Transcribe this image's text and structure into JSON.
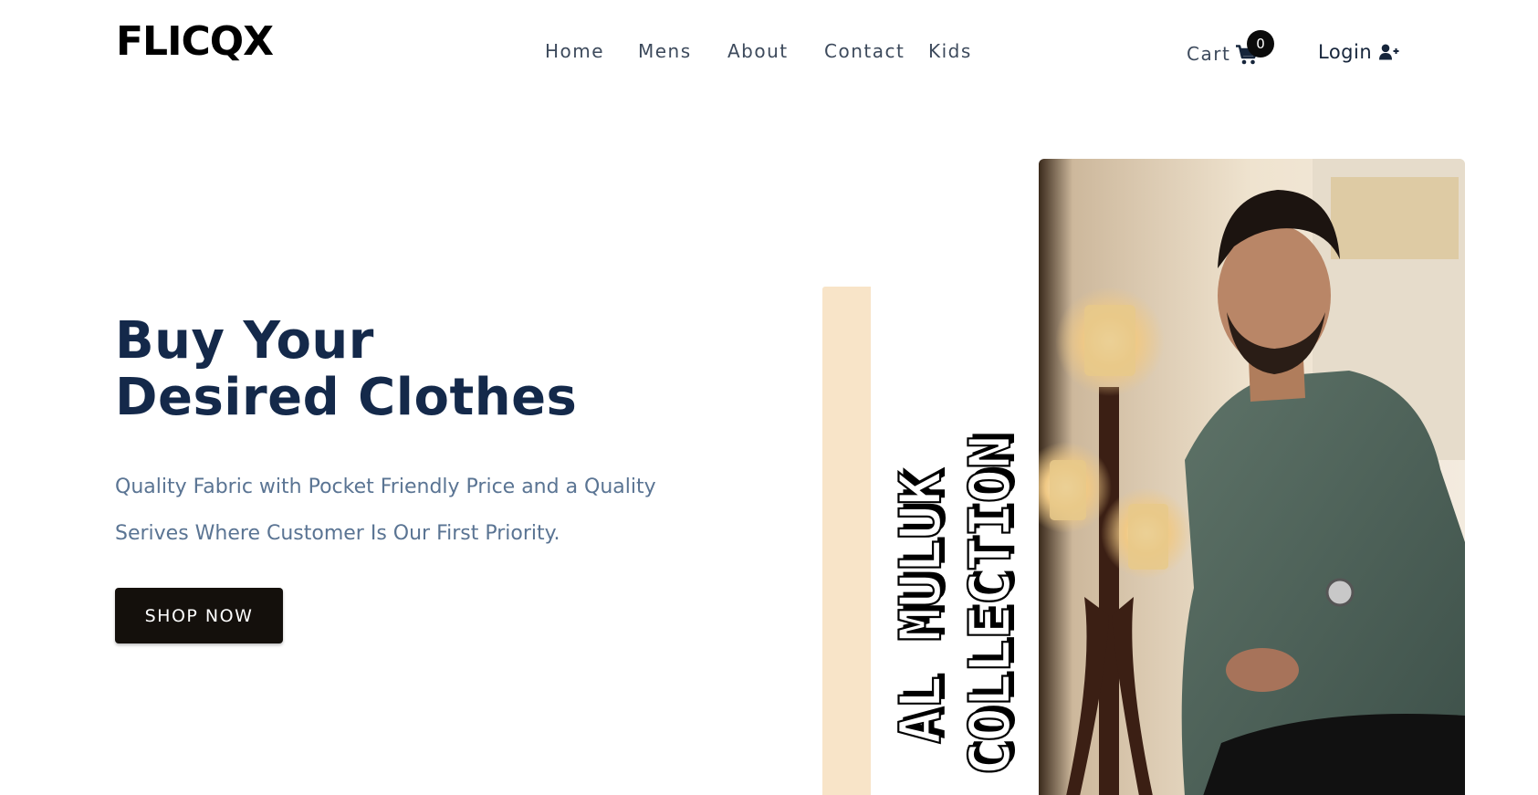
{
  "header": {
    "logo": "FLICQX",
    "nav": [
      {
        "label": "Home"
      },
      {
        "label": "Mens"
      },
      {
        "label": "About"
      },
      {
        "label": "Contact"
      },
      {
        "label": "Kids"
      }
    ],
    "cart": {
      "label": "Cart",
      "count": "0",
      "icon": "cart-icon"
    },
    "login": {
      "label": "Login",
      "icon": "user-plus-icon"
    }
  },
  "hero": {
    "title_line1": "Buy Your",
    "title_line2": "Desired Clothes",
    "subtitle_line1": "Quality Fabric with Pocket Friendly Price and a Quality",
    "subtitle_line2": "Serives Where Customer Is Our First Priority.",
    "cta_label": "SHOP NOW",
    "banner_line1": "AL MULUK",
    "banner_line2": "COLLECTION"
  },
  "colors": {
    "heading": "#14294a",
    "subtitle": "#5a7493",
    "nav_text": "#3d4a5c",
    "button_bg": "#14100c",
    "accent_strip": "#f8e4c8"
  }
}
